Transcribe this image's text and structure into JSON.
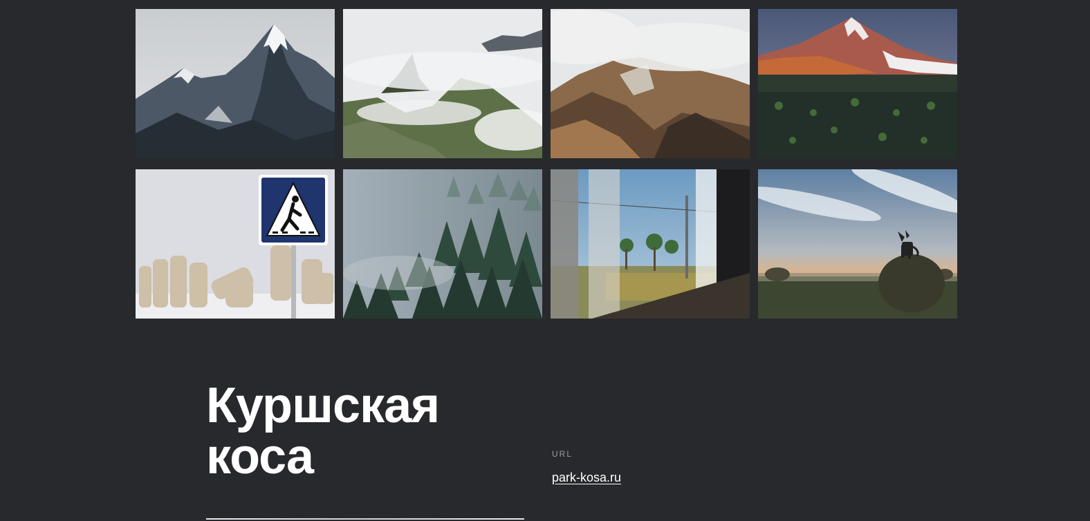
{
  "gallery": {
    "photos": [
      {
        "name": "snowy-mountain-peaks-photo"
      },
      {
        "name": "foggy-mountain-peak-photo"
      },
      {
        "name": "volcanic-hills-clouds-photo"
      },
      {
        "name": "volcano-at-sunset-photo"
      },
      {
        "name": "pedestrian-crossing-sign-photo"
      },
      {
        "name": "foggy-pine-forest-photo"
      },
      {
        "name": "train-window-view-photo"
      },
      {
        "name": "dog-on-haystack-photo"
      }
    ]
  },
  "place": {
    "title_line1": "Куршская",
    "title_line2": "коса",
    "url_label": "URL",
    "url_text": "park-kosa.ru"
  }
}
